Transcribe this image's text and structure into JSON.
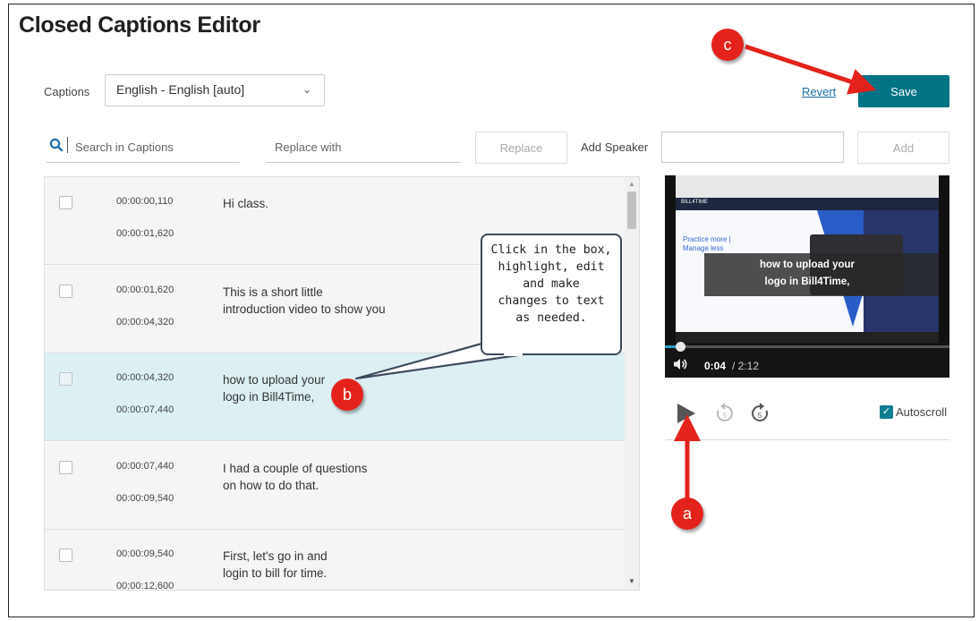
{
  "page": {
    "title": "Closed Captions Editor"
  },
  "toolbar": {
    "captions_label": "Captions",
    "captions_value": "English - English [auto]",
    "revert_label": "Revert",
    "save_label": "Save"
  },
  "search": {
    "search_placeholder": "Search in Captions",
    "replace_placeholder": "Replace with",
    "replace_button": "Replace",
    "add_speaker_label": "Add Speaker",
    "add_button": "Add"
  },
  "captions": [
    {
      "start": "00:00:00,110",
      "end": "00:00:01,620",
      "text": "Hi class.",
      "selected": false
    },
    {
      "start": "00:00:01,620",
      "end": "00:00:04,320",
      "text": "This is a short little\nintroduction video to show you",
      "selected": false
    },
    {
      "start": "00:00:04,320",
      "end": "00:00:07,440",
      "text": "how to upload your\nlogo in Bill4Time,",
      "selected": true
    },
    {
      "start": "00:00:07,440",
      "end": "00:00:09,540",
      "text": "I had a couple of questions\non how to do that.",
      "selected": false
    },
    {
      "start": "00:00:09,540",
      "end": "00:00:12,600",
      "text": "First, let's go in and\nlogin to bill for time.",
      "selected": false
    }
  ],
  "video": {
    "caption_line1": "how to upload your",
    "caption_line2": "logo in Bill4Time,",
    "current_time": "0:04",
    "duration": "/ 2:12",
    "progress": 0.03,
    "site_brand": "BILL4TIME",
    "site_heading_1": "Practice more |",
    "site_heading_2": "Manage less"
  },
  "controls": {
    "back_seconds": "5",
    "forward_seconds": "5",
    "autoscroll_label": "Autoscroll",
    "autoscroll_checked": true
  },
  "annotations": {
    "callout_text": "Click in the box,\nhighlight, edit\nand make\nchanges to text\nas needed.",
    "badge_a": "a",
    "badge_b": "b",
    "badge_c": "c"
  },
  "colors": {
    "accent": "#007385",
    "selected_row": "#dcf0f3",
    "badge": "#e3231b",
    "link": "#1a6ea8"
  }
}
